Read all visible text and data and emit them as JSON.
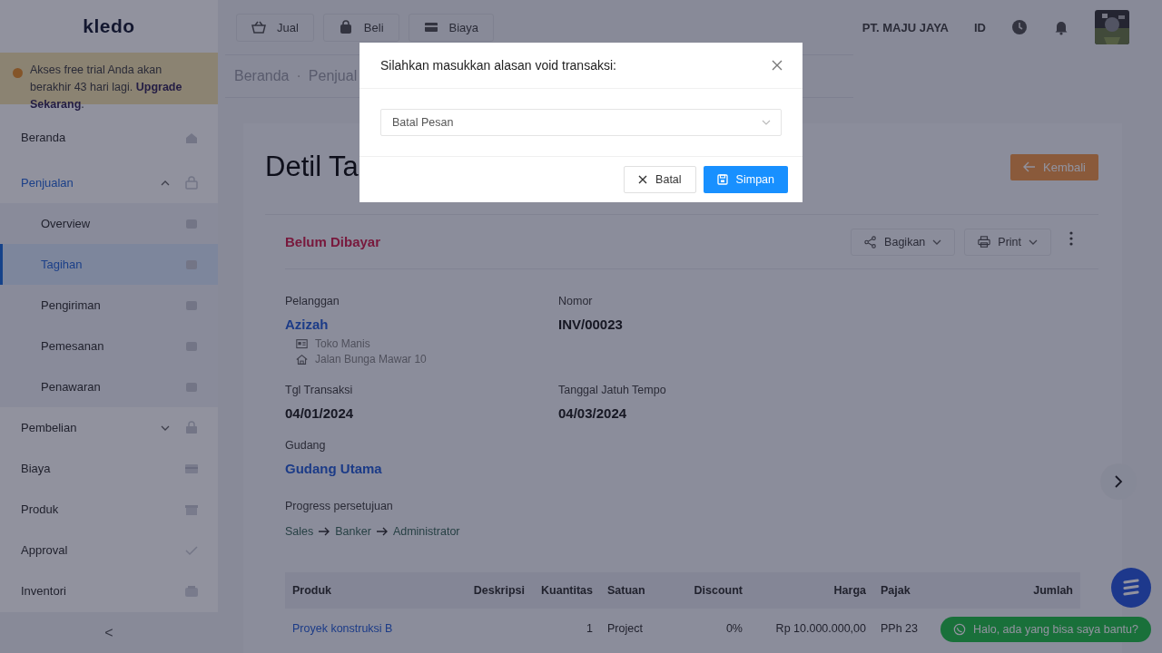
{
  "sidebar": {
    "logo": "kledo",
    "trial_notice": "Akses free trial Anda akan berakhir 43 hari lagi. **Upgrade Sekarang**.",
    "items": [
      {
        "kind": "link",
        "label": "Beranda",
        "selected": false
      },
      {
        "kind": "group",
        "label": "Penjualan",
        "selected": false,
        "expanded": true,
        "children": [
          {
            "label": "Overview",
            "selected": false
          },
          {
            "label": "Tagihan",
            "selected": true
          },
          {
            "label": "Pengiriman",
            "selected": false
          },
          {
            "label": "Pemesanan",
            "selected": false
          },
          {
            "label": "Penawaran",
            "selected": false
          }
        ]
      },
      {
        "kind": "group",
        "label": "Pembelian",
        "selected": false,
        "expanded": false
      },
      {
        "kind": "link",
        "label": "Biaya",
        "selected": false
      },
      {
        "kind": "link",
        "label": "Produk",
        "selected": false
      },
      {
        "kind": "link",
        "label": "Approval",
        "selected": false
      },
      {
        "kind": "link",
        "label": "Inventori",
        "selected": false
      }
    ],
    "collapse": "<"
  },
  "topbar": {
    "quick_buttons": [
      "Jual",
      "Beli",
      "Biaya"
    ],
    "company": "PT. MAJU JAYA",
    "language": "ID"
  },
  "breadcrumb": [
    "Beranda",
    "·",
    "Penjual"
  ],
  "page": {
    "title": "Detil Ta",
    "back_button": "Kembali",
    "status": "Belum Dibayar",
    "actions": [
      "Bagikan",
      "Print"
    ],
    "fields": [
      {
        "label": "Pelanggan",
        "value": "Azizah",
        "kind": "link",
        "details": [
          "Toko Manis",
          "Jalan Bunga Mawar 10"
        ]
      },
      {
        "label": "Nomor",
        "value": "INV/00023",
        "kind": "plain"
      },
      {
        "label": "Tgl Transaksi",
        "value": "04/01/2024",
        "kind": "plain"
      },
      {
        "label": "Tanggal Jatuh Tempo",
        "value": "04/03/2024",
        "kind": "plain"
      },
      {
        "label": "Gudang",
        "value": "Gudang Utama",
        "kind": "link"
      }
    ],
    "approval": {
      "label": "Progress persetujuan",
      "steps": [
        "Sales",
        "Banker",
        "Administrator"
      ]
    },
    "table": {
      "columns": [
        "Produk",
        "Deskripsi",
        "Kuantitas",
        "Satuan",
        "Discount",
        "Harga",
        "Pajak",
        "Jumlah"
      ],
      "rows": [
        [
          "Proyek konstruksi B",
          "",
          "1",
          "Project",
          "0%",
          "Rp 10.000.000,00",
          "PPh 23",
          ""
        ]
      ]
    }
  },
  "chat_bubble": "Halo, ada yang bisa saya bantu?",
  "modal": {
    "title": "Silahkan masukkan alasan void transaksi:",
    "select_value": "Batal Pesan",
    "buttons": [
      {
        "label": "Batal",
        "kind": "cancel"
      },
      {
        "label": "Simpan",
        "kind": "save"
      }
    ]
  }
}
